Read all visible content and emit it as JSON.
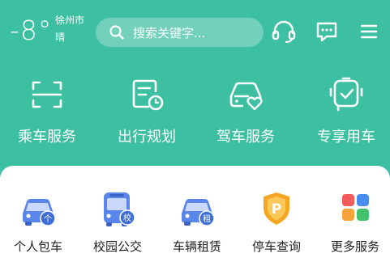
{
  "header": {
    "temperature": "-8°",
    "city": "徐州市",
    "weather": "晴",
    "search_placeholder": "搜索关键字..."
  },
  "icons": {
    "search": "search-icon",
    "support": "headset-icon",
    "messages": "message-icon",
    "menu": "menu-icon"
  },
  "main_services": [
    {
      "label": "乘车服务",
      "icon": "scan-icon"
    },
    {
      "label": "出行规划",
      "icon": "route-clock-icon"
    },
    {
      "label": "驾车服务",
      "icon": "car-heart-icon"
    },
    {
      "label": "专享用车",
      "icon": "van-check-icon"
    }
  ],
  "sub_services": [
    {
      "label": "个人包车",
      "badge": "个",
      "icon": "car-icon"
    },
    {
      "label": "校园公交",
      "badge": "校",
      "icon": "bus-icon"
    },
    {
      "label": "车辆租赁",
      "badge": "租",
      "icon": "car-icon"
    },
    {
      "label": "停车查询",
      "badge": "P",
      "icon": "parking-icon"
    },
    {
      "label": "更多服务",
      "badge": "",
      "icon": "grid-icon"
    }
  ],
  "colors": {
    "brand": "#3dbfa1",
    "blue": "#4f7ce8",
    "parking": "#f5a623",
    "grid_red": "#f25b5b",
    "grid_blue": "#4a8df0",
    "grid_orange": "#f6a33b",
    "grid_green": "#43c26e"
  }
}
